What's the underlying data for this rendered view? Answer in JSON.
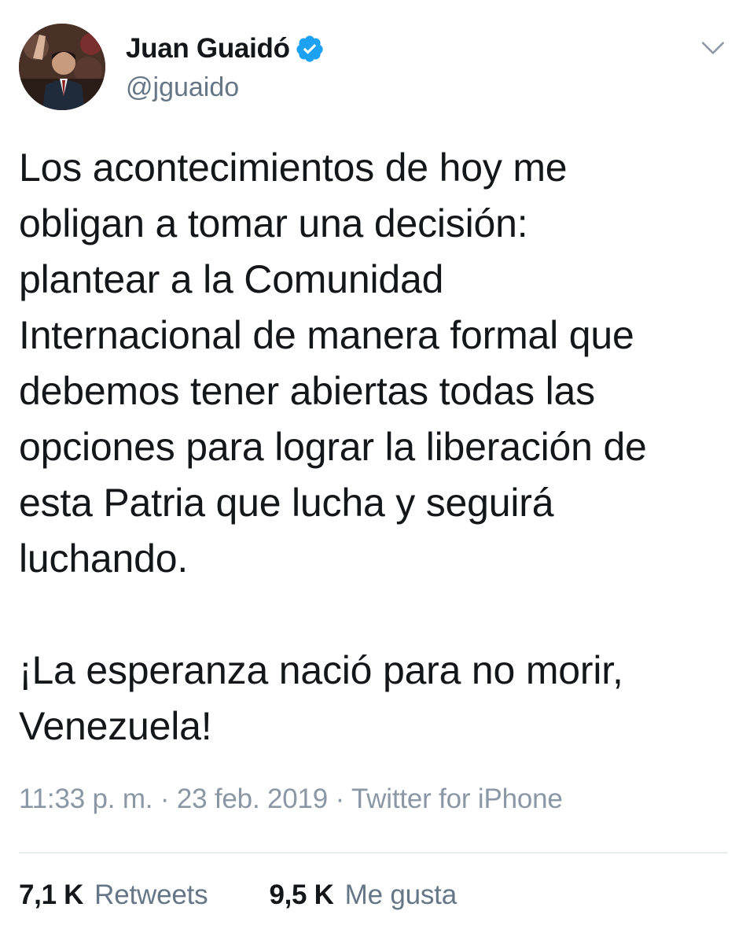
{
  "tweet": {
    "author": {
      "display_name": "Juan Guaidó",
      "handle": "@jguaido",
      "verified": true,
      "verified_icon": "verified-badge-icon",
      "avatar_icon": "avatar"
    },
    "menu_icon": "chevron-down-icon",
    "body": {
      "paragraph_1": "Los acontecimientos de hoy me\nobligan a tomar una decisión:\nplantear a la Comunidad\nInternacional de manera formal que\ndebemos tener abiertas todas las\nopciones para lograr la liberación de\nesta Patria que lucha y seguirá\nluchando.",
      "paragraph_2": "¡La esperanza nació para no morir,\nVenezuela!"
    },
    "meta": {
      "time": "11:33 p. m.",
      "separator": " · ",
      "date": "23 feb. 2019",
      "source": "Twitter for iPhone"
    },
    "stats": {
      "retweets_count": "7,1 K",
      "retweets_label": "Retweets",
      "likes_count": "9,5 K",
      "likes_label": "Me gusta"
    }
  },
  "colors": {
    "text_primary": "#14171a",
    "text_secondary": "#657786",
    "verified_blue": "#1da1f2",
    "divider": "#e6ecf0"
  }
}
